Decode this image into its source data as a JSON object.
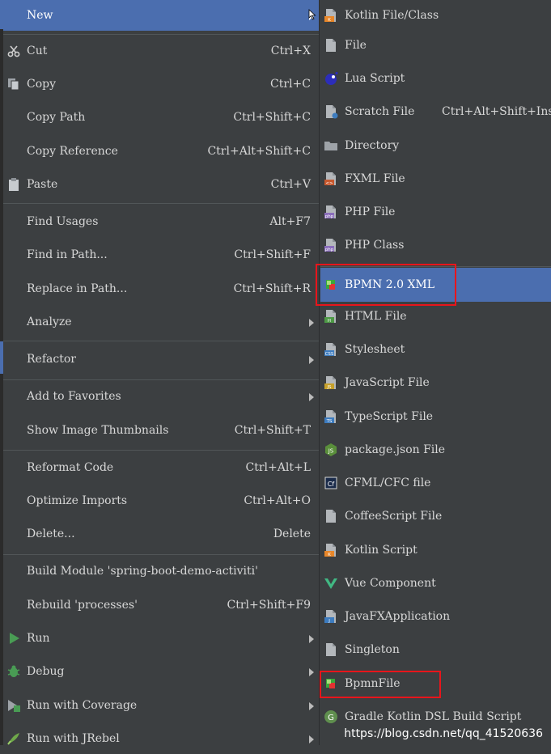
{
  "main_menu": {
    "items": [
      {
        "label": "New",
        "shortcut": "",
        "submenu": true,
        "icon": "none"
      },
      {
        "label": "Cut",
        "shortcut": "Ctrl+X",
        "submenu": false,
        "icon": "scissors-icon"
      },
      {
        "label": "Copy",
        "shortcut": "Ctrl+C",
        "submenu": false,
        "icon": "copy-icon"
      },
      {
        "label": "Copy Path",
        "shortcut": "Ctrl+Shift+C",
        "submenu": false,
        "icon": "none"
      },
      {
        "label": "Copy Reference",
        "shortcut": "Ctrl+Alt+Shift+C",
        "submenu": false,
        "icon": "none"
      },
      {
        "label": "Paste",
        "shortcut": "Ctrl+V",
        "submenu": false,
        "icon": "clipboard-icon"
      },
      {
        "label": "Find Usages",
        "shortcut": "Alt+F7",
        "submenu": false,
        "icon": "none"
      },
      {
        "label": "Find in Path...",
        "shortcut": "Ctrl+Shift+F",
        "submenu": false,
        "icon": "none"
      },
      {
        "label": "Replace in Path...",
        "shortcut": "Ctrl+Shift+R",
        "submenu": false,
        "icon": "none"
      },
      {
        "label": "Analyze",
        "shortcut": "",
        "submenu": true,
        "icon": "none"
      },
      {
        "label": "Refactor",
        "shortcut": "",
        "submenu": true,
        "icon": "none"
      },
      {
        "label": "Add to Favorites",
        "shortcut": "",
        "submenu": true,
        "icon": "none"
      },
      {
        "label": "Show Image Thumbnails",
        "shortcut": "Ctrl+Shift+T",
        "submenu": false,
        "icon": "none"
      },
      {
        "label": "Reformat Code",
        "shortcut": "Ctrl+Alt+L",
        "submenu": false,
        "icon": "none"
      },
      {
        "label": "Optimize Imports",
        "shortcut": "Ctrl+Alt+O",
        "submenu": false,
        "icon": "none"
      },
      {
        "label": "Delete...",
        "shortcut": "Delete",
        "submenu": false,
        "icon": "none"
      },
      {
        "label": "Build Module 'spring-boot-demo-activiti'",
        "shortcut": "",
        "submenu": false,
        "icon": "none"
      },
      {
        "label": "Rebuild 'processes'",
        "shortcut": "Ctrl+Shift+F9",
        "submenu": false,
        "icon": "none"
      },
      {
        "label": "Run",
        "shortcut": "",
        "submenu": true,
        "icon": "run-icon"
      },
      {
        "label": "Debug",
        "shortcut": "",
        "submenu": true,
        "icon": "bug-icon"
      },
      {
        "label": "Run with Coverage",
        "shortcut": "",
        "submenu": true,
        "icon": "coverage-icon"
      },
      {
        "label": "Run with JRebel",
        "shortcut": "",
        "submenu": true,
        "icon": "rocket-icon"
      }
    ]
  },
  "sub_menu": {
    "items": [
      {
        "label": "Kotlin File/Class",
        "shortcut": "",
        "icon": "kotlin-file-icon"
      },
      {
        "label": "File",
        "shortcut": "",
        "icon": "file-icon"
      },
      {
        "label": "Lua Script",
        "shortcut": "",
        "icon": "lua-icon"
      },
      {
        "label": "Scratch File",
        "shortcut": "Ctrl+Alt+Shift+Insert",
        "icon": "scratch-file-icon"
      },
      {
        "label": "Directory",
        "shortcut": "",
        "icon": "folder-icon"
      },
      {
        "label": "FXML File",
        "shortcut": "",
        "icon": "fxml-icon"
      },
      {
        "label": "PHP File",
        "shortcut": "",
        "icon": "php-file-icon"
      },
      {
        "label": "PHP Class",
        "shortcut": "",
        "icon": "php-class-icon"
      },
      {
        "label": "BPMN 2.0 XML",
        "shortcut": "",
        "icon": "bpmn-icon"
      },
      {
        "label": "HTML File",
        "shortcut": "",
        "icon": "html-icon"
      },
      {
        "label": "Stylesheet",
        "shortcut": "",
        "icon": "css-icon"
      },
      {
        "label": "JavaScript File",
        "shortcut": "",
        "icon": "js-icon"
      },
      {
        "label": "TypeScript File",
        "shortcut": "",
        "icon": "ts-icon"
      },
      {
        "label": "package.json File",
        "shortcut": "",
        "icon": "nodejs-icon"
      },
      {
        "label": "CFML/CFC file",
        "shortcut": "",
        "icon": "cfml-icon"
      },
      {
        "label": "CoffeeScript File",
        "shortcut": "",
        "icon": "coffeescript-icon"
      },
      {
        "label": "Kotlin Script",
        "shortcut": "",
        "icon": "kotlin-script-icon"
      },
      {
        "label": "Vue Component",
        "shortcut": "",
        "icon": "vue-icon"
      },
      {
        "label": "JavaFXApplication",
        "shortcut": "",
        "icon": "javafx-icon"
      },
      {
        "label": "Singleton",
        "shortcut": "",
        "icon": "singleton-icon"
      },
      {
        "label": "BpmnFile",
        "shortcut": "",
        "icon": "bpmn-file-icon"
      },
      {
        "label": "Gradle Kotlin DSL Build Script",
        "shortcut": "",
        "icon": "gradle-icon"
      }
    ]
  },
  "watermark": "https://blog.csdn.net/qq_41520636",
  "colors": {
    "background": "#3c3f41",
    "highlight": "#4b6eaf",
    "text": "#d8d8d8",
    "annotation": "#e8151b"
  }
}
